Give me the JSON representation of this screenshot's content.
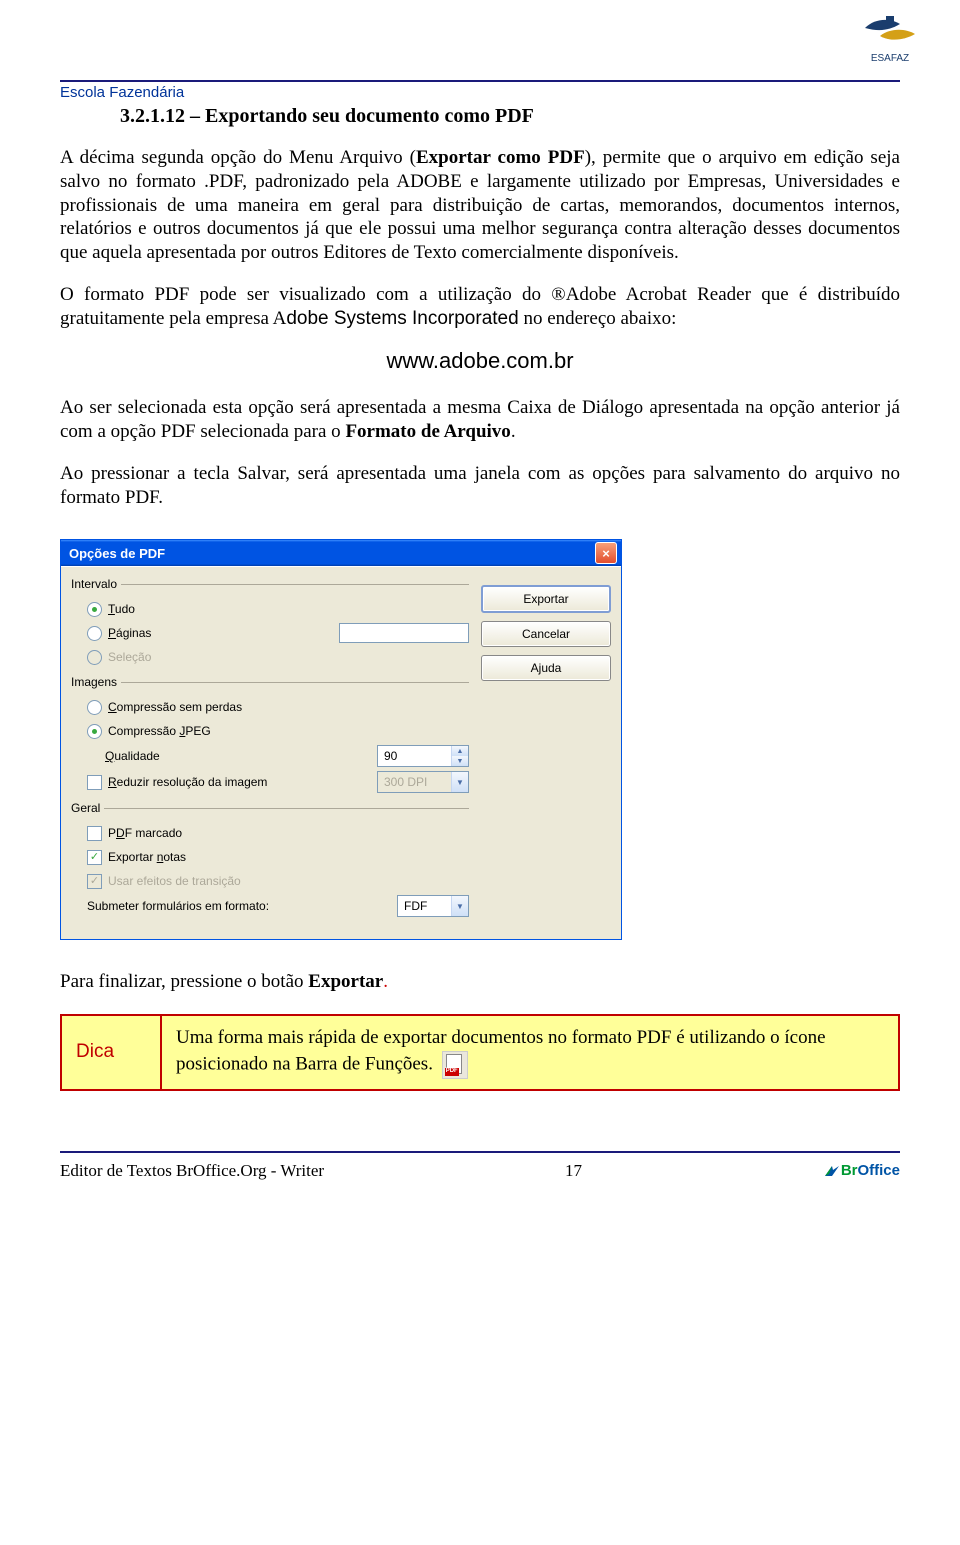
{
  "header": {
    "logo_text": "ESAFAZ",
    "school_name": "Escola Fazendária"
  },
  "section": {
    "number": "3.2.1.12",
    "title": " – Exportando seu documento como PDF"
  },
  "para1_a": "A décima segunda opção do Menu Arquivo (",
  "para1_b": "Exportar como PDF",
  "para1_c": "), permite que o arquivo em edição seja salvo no formato .PDF, padronizado pela ADOBE e largamente utilizado por Empresas, Universidades e profissionais de uma maneira em geral para distribuição de cartas, memorandos, documentos internos, relatórios e outros documentos já que ele possui uma melhor segurança contra alteração desses documentos que aquela apresentada por outros Editores de Texto comercialmente disponíveis.",
  "para2_a": "O formato PDF pode ser visualizado com a utilização do ®Adobe Acrobat Reader que é distribuído gratuitamente pela empresa A",
  "para2_b": "dobe Systems Incorporated",
  "para2_c": " no endereço abaixo:",
  "url": "www.adobe.com.br",
  "para3_a": "Ao ser selecionada esta opção será apresentada a mesma Caixa de Diálogo apresentada na opção anterior já com a opção PDF selecionada para o ",
  "para3_b": "Formato de Arquivo",
  "para3_c": ".",
  "para4": "Ao pressionar a tecla Salvar, será apresentada uma janela com as opções para salvamento do arquivo no formato PDF.",
  "dialog": {
    "title": "Opções de PDF",
    "group_intervalo": "Intervalo",
    "opt_tudo": "Tudo",
    "opt_paginas": "Páginas",
    "opt_selecao": "Seleção",
    "group_imagens": "Imagens",
    "opt_comp_sem_perdas": "Compressão sem perdas",
    "opt_comp_jpeg": "Compressão JPEG",
    "lbl_qualidade": "Qualidade",
    "val_qualidade": "90",
    "lbl_reduzir": "Reduzir resolução da imagem",
    "val_dpi": "300 DPI",
    "group_geral": "Geral",
    "opt_pdf_marcado": "PDF marcado",
    "opt_exportar_notas": "Exportar notas",
    "opt_usar_efeitos": "Usar efeitos de transição",
    "lbl_submeter": "Submeter formulários em formato:",
    "val_submeter": "FDF",
    "btn_exportar": "Exportar",
    "btn_cancelar": "Cancelar",
    "btn_ajuda": "Ajuda"
  },
  "para5_a": "Para finalizar, pressione o botão ",
  "para5_b": "Exportar",
  "para5_c": ".",
  "dica": {
    "label": "Dica",
    "text": "Uma forma mais rápida de exportar documentos no formato PDF é utilizando o ícone posicionado na Barra de Funções."
  },
  "footer": {
    "left": "Editor de Textos BrOffice.Org  -  Writer",
    "page": "17",
    "logo_br": "Br",
    "logo_office": "Office"
  }
}
